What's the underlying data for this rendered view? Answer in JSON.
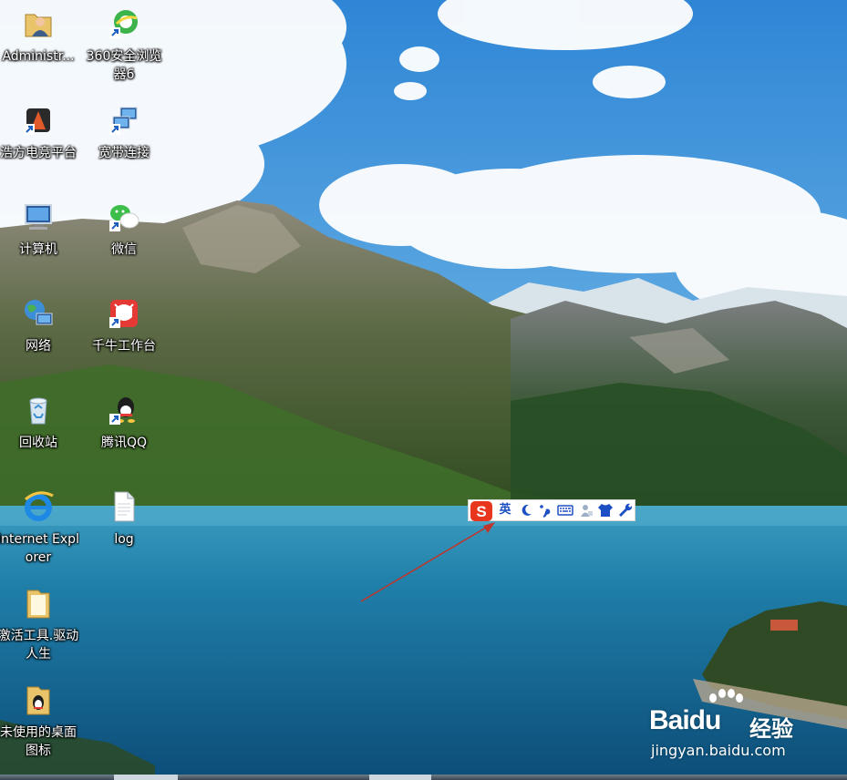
{
  "desktop_icons": [
    {
      "label": "Administr...",
      "icon": "user-folder-icon"
    },
    {
      "label": "360安全浏览器6",
      "icon": "360-browser-icon"
    },
    {
      "label": "浩方电竞平台",
      "icon": "haofang-platform-icon"
    },
    {
      "label": "宽带连接",
      "icon": "broadband-connection-icon"
    },
    {
      "label": "计算机",
      "icon": "computer-icon"
    },
    {
      "label": "微信",
      "icon": "wechat-icon"
    },
    {
      "label": "网络",
      "icon": "network-icon"
    },
    {
      "label": "千牛工作台",
      "icon": "qianniu-icon"
    },
    {
      "label": "回收站",
      "icon": "recycle-bin-icon"
    },
    {
      "label": "腾讯QQ",
      "icon": "qq-icon"
    },
    {
      "label": "Internet Explorer",
      "icon": "internet-explorer-icon"
    },
    {
      "label": "log",
      "icon": "text-file-icon"
    },
    {
      "label": "激活工具.驱动人生",
      "icon": "folder-icon"
    },
    {
      "label": "未使用的桌面图标",
      "icon": "folder-penguin-icon"
    }
  ],
  "ime_toolbar": {
    "logo": "S",
    "language_mode": "英",
    "buttons": [
      "half-width-moon-icon",
      "punctuation-icon",
      "keyboard-icon",
      "user-icon",
      "skin-shirt-icon",
      "settings-wrench-icon"
    ],
    "brand_color": "#e8361e",
    "icon_color": "#1c4fc4"
  },
  "annotation": {
    "type": "arrow",
    "color": "#c0352b"
  },
  "watermark": {
    "brand": "Baidu",
    "product": "经验",
    "url": "jingyan.baidu.com"
  }
}
